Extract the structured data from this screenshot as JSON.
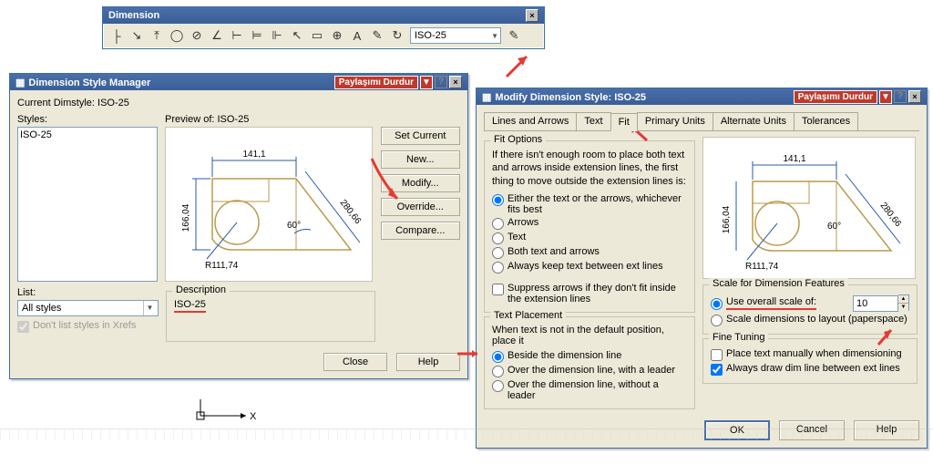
{
  "toolbar": {
    "title": "Dimension",
    "dropdown_value": "ISO-25"
  },
  "share_label": "Paylaşımı Durdur",
  "dsm": {
    "title": "Dimension Style Manager",
    "current_label": "Current Dimstyle: ISO-25",
    "styles_label": "Styles:",
    "styles_item": "ISO-25",
    "preview_label": "Preview of: ISO-25",
    "list_label": "List:",
    "list_value": "All styles",
    "xrefs_label": "Don't list styles in Xrefs",
    "desc_label": "Description",
    "desc_value": "ISO-25",
    "buttons": {
      "set_current": "Set Current",
      "new": "New...",
      "modify": "Modify...",
      "override": "Override...",
      "compare": "Compare...",
      "close": "Close",
      "help": "Help"
    }
  },
  "preview_dims": {
    "top": "141,1",
    "left": "166,04",
    "right": "280,66",
    "radius": "R111,74",
    "angle": "60°"
  },
  "modify": {
    "title": "Modify Dimension Style: ISO-25",
    "tabs": {
      "lines": "Lines and Arrows",
      "text": "Text",
      "fit": "Fit",
      "primary": "Primary Units",
      "alternate": "Alternate Units",
      "tolerances": "Tolerances"
    },
    "fit": {
      "legend": "Fit Options",
      "intro": "If there isn't enough room to place both text and arrows inside extension lines, the first thing to move outside the extension lines is:",
      "opt_either": "Either the text or the arrows, whichever fits best",
      "opt_arrows": "Arrows",
      "opt_text": "Text",
      "opt_both": "Both text and arrows",
      "opt_keep": "Always keep text between ext lines",
      "suppress": "Suppress arrows if they don't fit inside the extension lines"
    },
    "placement": {
      "legend": "Text Placement",
      "intro": "When text is not in the default position, place it",
      "opt_beside": "Beside the dimension line",
      "opt_over_leader": "Over the dimension line, with a leader",
      "opt_over_no": "Over the dimension line, without a leader"
    },
    "scale": {
      "legend": "Scale for Dimension Features",
      "opt_overall": "Use overall scale of:",
      "value": "10",
      "opt_layout": "Scale dimensions to layout (paperspace)"
    },
    "fine": {
      "legend": "Fine Tuning",
      "opt_manual": "Place text manually when dimensioning",
      "opt_always": "Always draw dim line between ext lines"
    },
    "buttons": {
      "ok": "OK",
      "cancel": "Cancel",
      "help": "Help"
    }
  }
}
